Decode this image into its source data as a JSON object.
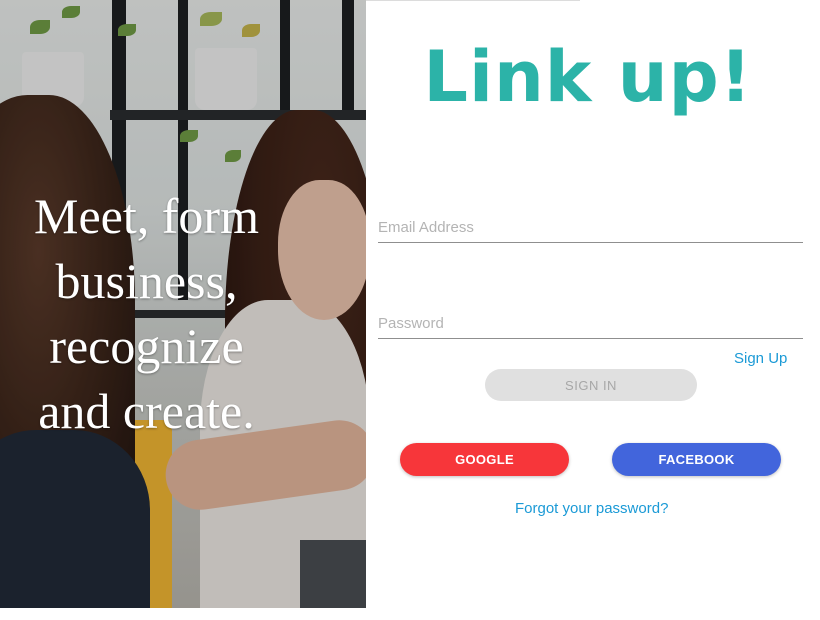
{
  "hero": {
    "tagline_lines": [
      "Meet, form",
      "business,",
      "recognize",
      "and create."
    ]
  },
  "brand": {
    "title": "Link up!"
  },
  "form": {
    "email_placeholder": "Email Address",
    "password_placeholder": "Password",
    "signup_label": "Sign Up",
    "signin_label": "SIGN IN",
    "google_label": "GOOGLE",
    "facebook_label": "FACEBOOK",
    "forgot_label": "Forgot your password?"
  },
  "colors": {
    "brand": "#2cb3a8",
    "link": "#1b9ad6",
    "google": "#f7363a",
    "facebook": "#4265dc",
    "signin_bg": "#e0e0e0"
  }
}
